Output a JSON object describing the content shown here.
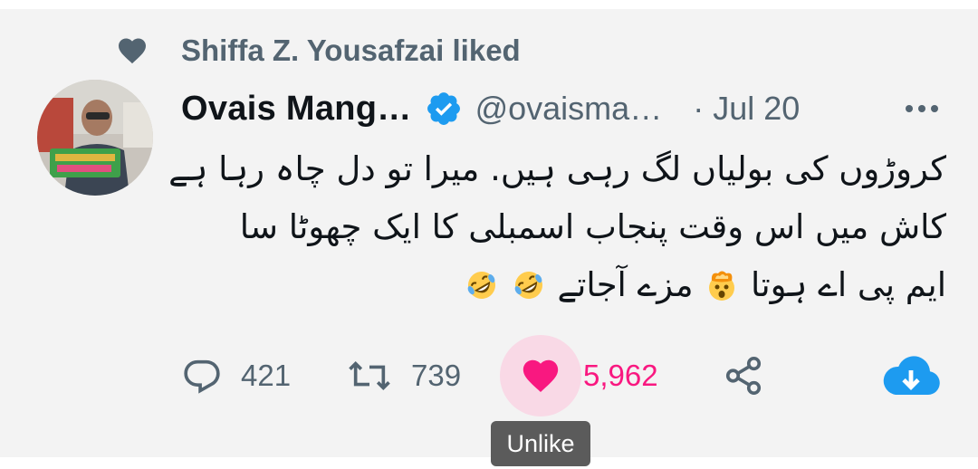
{
  "social_context": {
    "text": "Shiffa Z. Yousafzai liked",
    "icon": "heart-icon"
  },
  "tweet": {
    "display_name": "Ovais Mang…",
    "verified": true,
    "handle": "@ovaisma…",
    "separator": "·",
    "date": "Jul 20",
    "text_lines": [
      "کروڑوں کی بولیاں لگ رہی ہیں. میرا تو دل چاہ رہا ہے",
      "کاش میں اس وقت پنجاب اسمبلی کا ایک چھوٹا سا",
      "ایم پی اے ہوتا",
      "مزے آجاتے"
    ]
  },
  "actions": {
    "reply_count": "421",
    "retweet_count": "739",
    "like_count": "5,962",
    "liked": true
  },
  "tooltip": {
    "text": "Unlike"
  },
  "colors": {
    "like_pink": "#f91880",
    "verified_blue": "#1d9bf0",
    "muted": "#536471"
  }
}
